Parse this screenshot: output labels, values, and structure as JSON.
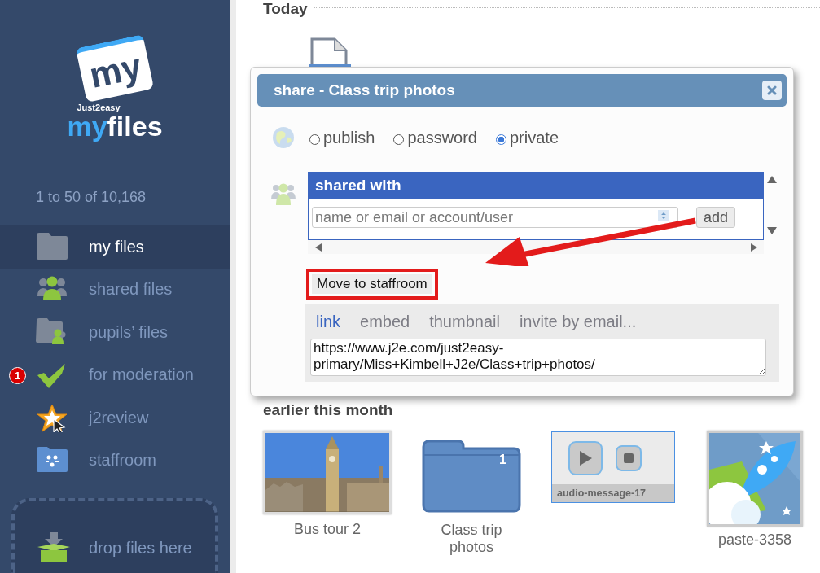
{
  "logo": {
    "mark": "my",
    "tagline": "Just2easy",
    "wordmark_1": "my",
    "wordmark_2": "files"
  },
  "file_count": "1 to 50 of 10,168",
  "sidebar": {
    "items": [
      {
        "kind": "folder",
        "label": "my files",
        "selected": true
      },
      {
        "kind": "shared",
        "label": "shared files",
        "selected": false
      },
      {
        "kind": "pupils",
        "label": "pupils’ files",
        "selected": false
      },
      {
        "kind": "moderation",
        "label": "for moderation",
        "selected": false,
        "badge": "1"
      },
      {
        "kind": "review",
        "label": "j2review",
        "selected": false
      },
      {
        "kind": "staffroom",
        "label": "staffroom",
        "selected": false
      }
    ]
  },
  "drop_zone": {
    "label": "drop files here"
  },
  "sections": [
    {
      "heading": "Today",
      "files": [
        {
          "kind": "document"
        }
      ]
    },
    {
      "heading": "earlier this month",
      "files": [
        {
          "name": "Bus tour 2"
        },
        {
          "kind": "folder",
          "name": "Class trip photos",
          "count": "1"
        },
        {
          "kind": "audio",
          "name": "audio-message-17"
        },
        {
          "name": "paste-3358"
        }
      ]
    }
  ],
  "share_dialog": {
    "title": "share - Class trip photos",
    "visibility": [
      {
        "label": "publish",
        "selected": false
      },
      {
        "label": "password",
        "selected": false
      },
      {
        "label": "private",
        "selected": true
      }
    ],
    "shared_with": {
      "heading": "shared with",
      "placeholder": "name or email or account/user",
      "add_button": "add"
    },
    "move_button": "Move to staffroom",
    "tabs": [
      {
        "label": "link",
        "selected": true
      },
      {
        "label": "embed",
        "selected": false
      },
      {
        "label": "thumbnail",
        "selected": false
      },
      {
        "label": "invite by email...",
        "selected": false
      }
    ],
    "link": "https://www.j2e.com/just2easy-primary/Miss+Kimbell+J2e/Class+trip+photos/"
  }
}
